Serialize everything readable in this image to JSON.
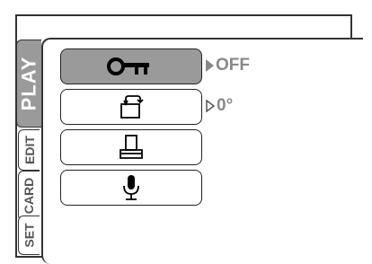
{
  "tabs": [
    {
      "id": "play",
      "label": "PLAY",
      "selected": true
    },
    {
      "id": "edit",
      "label": "EDIT",
      "selected": false
    },
    {
      "id": "card",
      "label": "CARD",
      "selected": false
    },
    {
      "id": "set",
      "label": "SET",
      "selected": false
    }
  ],
  "menu": {
    "items": [
      {
        "icon": "protect-key-icon",
        "value": "OFF",
        "selected": true
      },
      {
        "icon": "rotate-icon",
        "value": "0°",
        "selected": false
      },
      {
        "icon": "print-icon",
        "value": "",
        "selected": false
      },
      {
        "icon": "microphone-icon",
        "value": "",
        "selected": false
      }
    ]
  },
  "colors": {
    "selected_fill": "#9a9a9a",
    "value_text": "#888888",
    "border": "#333333"
  }
}
